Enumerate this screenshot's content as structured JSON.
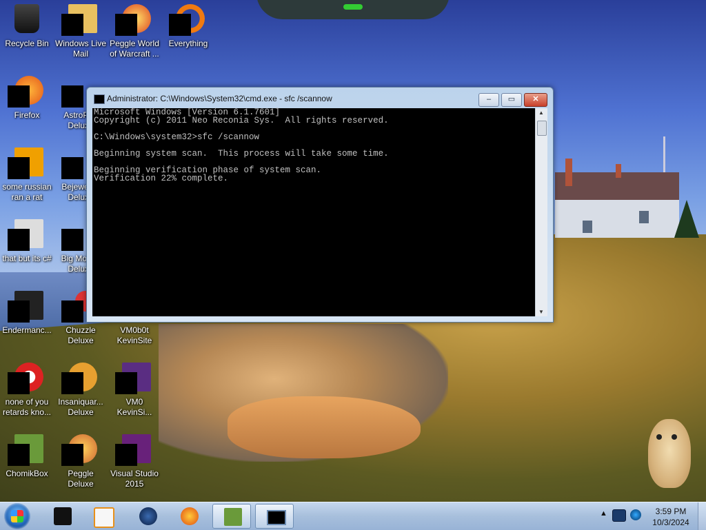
{
  "desktop": {
    "icons": [
      {
        "label": "Recycle Bin"
      },
      {
        "label": "Windows Live Mail"
      },
      {
        "label": "Peggle World of Warcraft ..."
      },
      {
        "label": "Everything"
      },
      {
        "label": "Firefox"
      },
      {
        "label": "AstroPop Deluxe"
      },
      {
        "label": "some russian ran a rat"
      },
      {
        "label": "Bejeweled Deluxe"
      },
      {
        "label": "that but its c#"
      },
      {
        "label": "Big Money Deluxe"
      },
      {
        "label": "Endermanc..."
      },
      {
        "label": "Chuzzle Deluxe"
      },
      {
        "label": "VM0b0t KevinSite"
      },
      {
        "label": "none of you retards kno..."
      },
      {
        "label": "Insaniquar... Deluxe"
      },
      {
        "label": "VM0 KevinSi..."
      },
      {
        "label": "ChomikBox"
      },
      {
        "label": "Peggle Deluxe"
      },
      {
        "label": "Visual Studio 2015"
      }
    ]
  },
  "cmd": {
    "title": "Administrator: C:\\Windows\\System32\\cmd.exe - sfc  /scannow",
    "minimize": "–",
    "maximize": "▭",
    "close": "✕",
    "lines": [
      "Microsoft Windows [Version 6.1.7601]",
      "Copyright (c) 2011 Neo Reconia Sys.  All rights reserved.",
      "",
      "C:\\Windows\\system32>sfc /scannow",
      "",
      "Beginning system scan.  This process will take some time.",
      "",
      "Beginning verification phase of system scan.",
      "Verification 22% complete."
    ],
    "progress_percent": 22
  },
  "taskbar": {
    "time": "3:59 PM",
    "date": "10/3/2024",
    "tray_expand": "▲",
    "pinned": [
      "start-button",
      "terminal-app",
      "media-player",
      "network-globe",
      "firefox",
      "chomikbox",
      "cmd-window"
    ]
  }
}
